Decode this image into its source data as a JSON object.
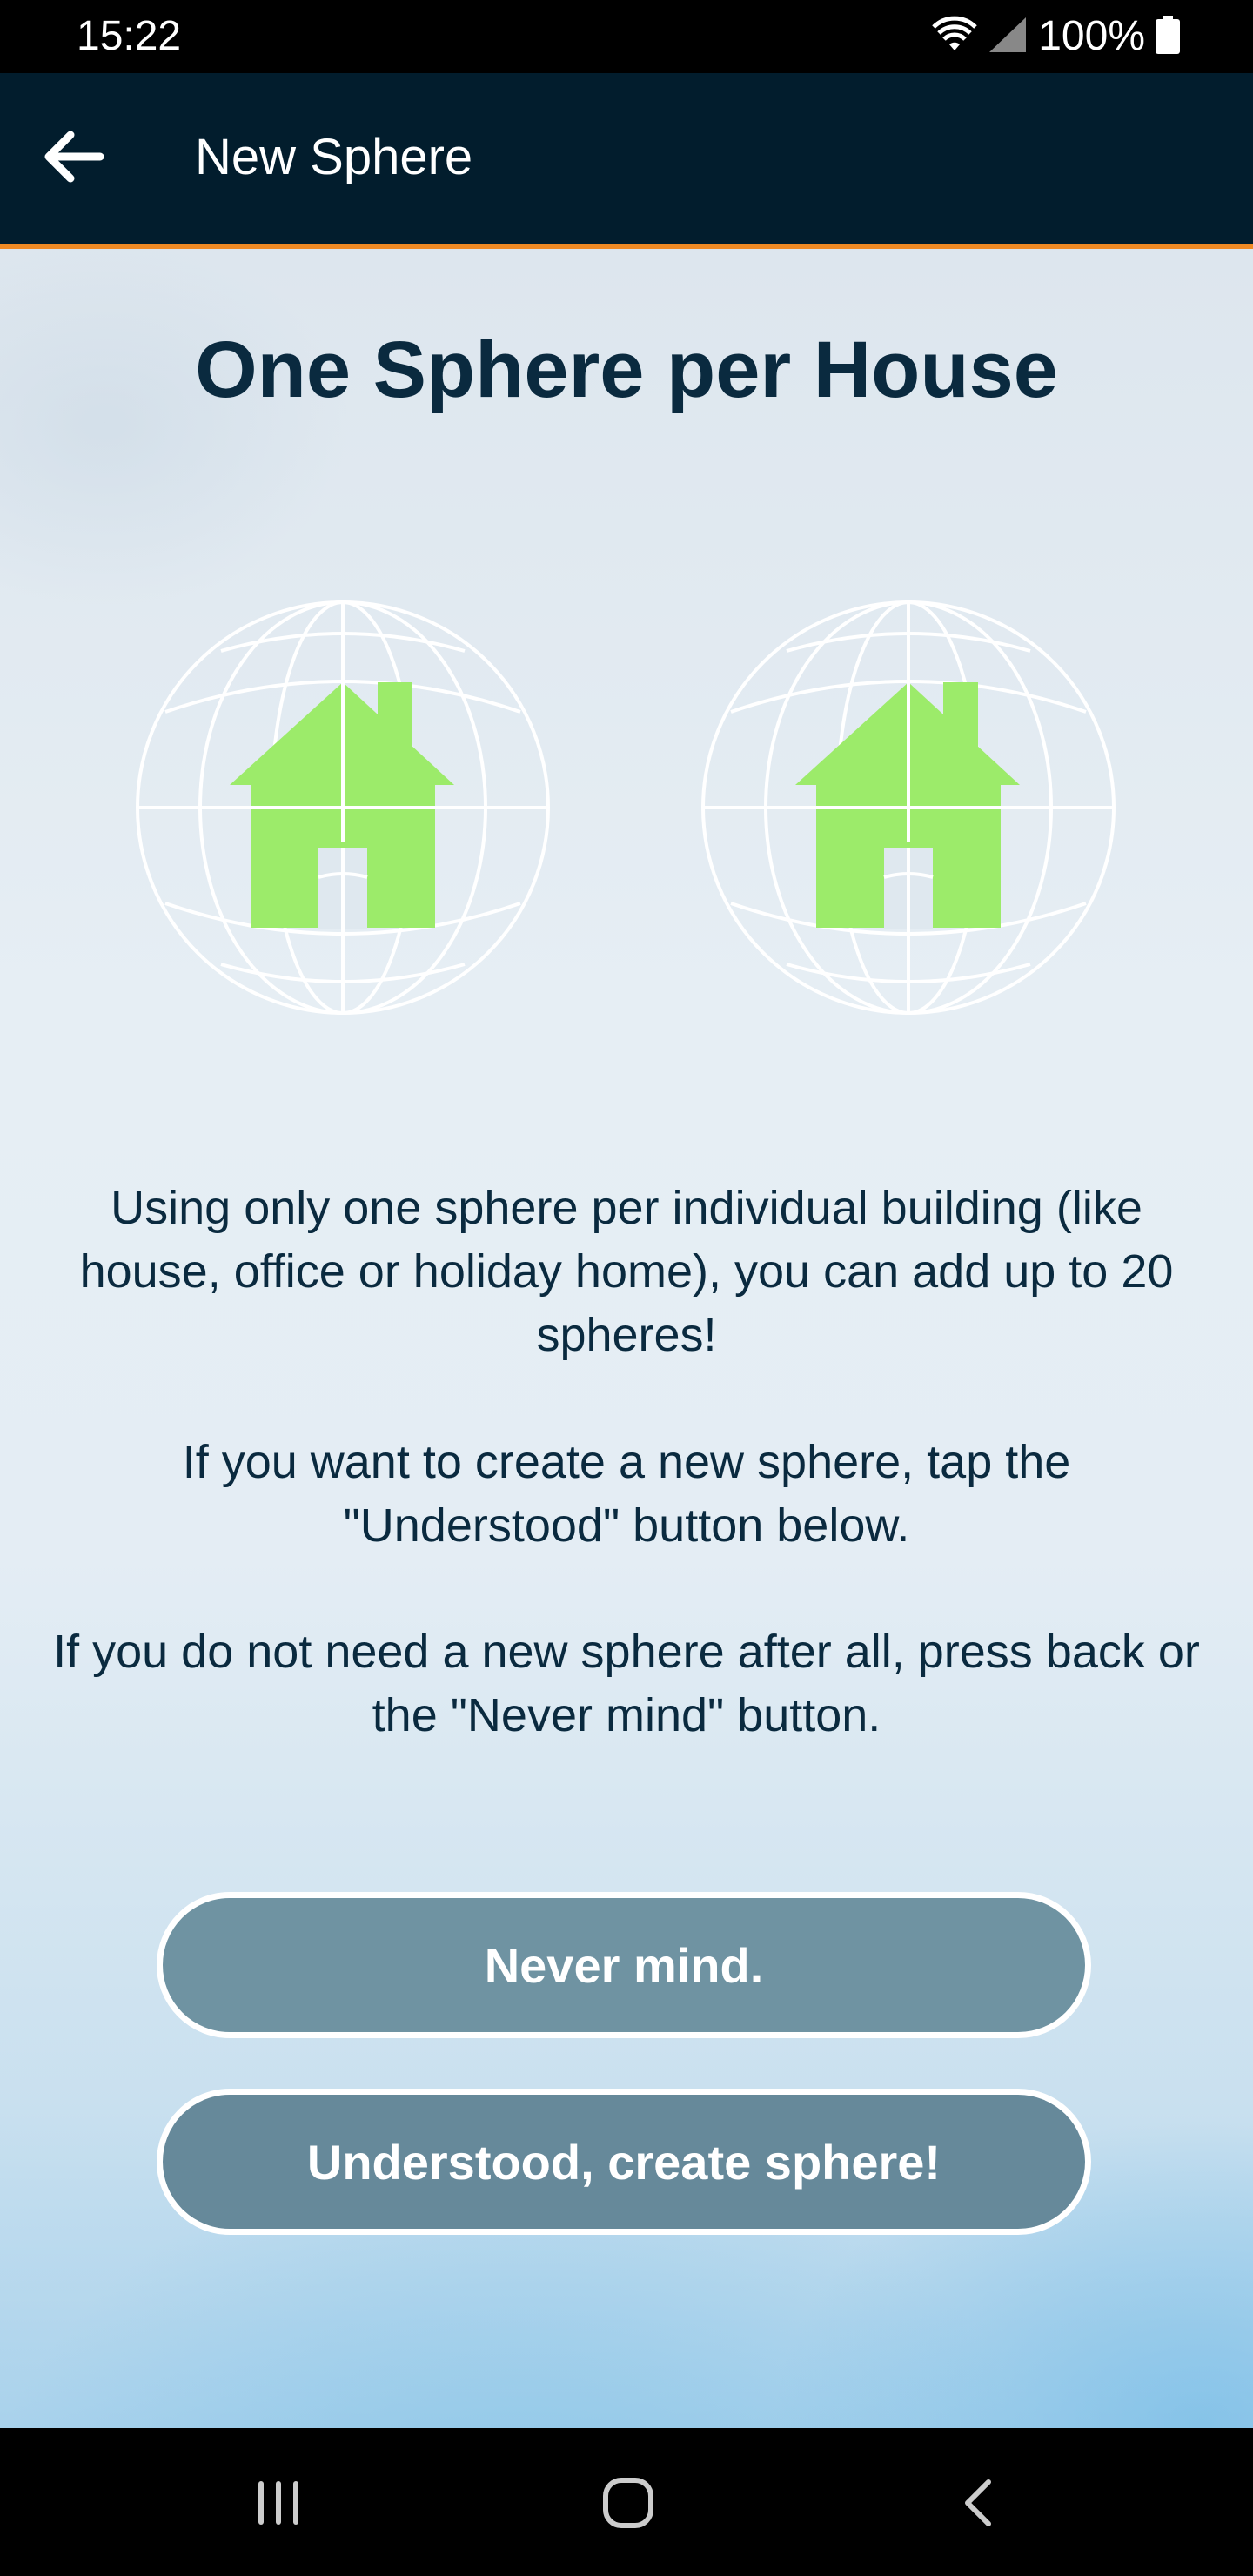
{
  "status_bar": {
    "time": "15:22",
    "battery": "100%",
    "icons": [
      "wifi-icon",
      "signal-icon",
      "battery-icon"
    ]
  },
  "app_bar": {
    "title": "New Sphere",
    "back_icon": "arrow-left-icon",
    "background_color": "#021d2d",
    "accent_color": "#f08a24"
  },
  "main": {
    "headline": "One Sphere per House",
    "illustrations": [
      "sphere-house-icon",
      "sphere-house-icon"
    ],
    "house_color": "#9ceb6a",
    "paragraphs": [
      "Using only one sphere per individual building (like house, office or holiday home), you can add up to 20 spheres!",
      "If you want to create a new sphere, tap the \"Understood\" button below.",
      "If you do not need a new sphere after all, press back or the \"Never mind\" button."
    ],
    "buttons": {
      "never_mind": "Never mind.",
      "understood": "Understood, create sphere!"
    },
    "text_color": "#0a2a3f",
    "button_color": "#6f93a2"
  },
  "nav_bar": {
    "icons": [
      "recents-icon",
      "home-icon",
      "back-icon"
    ]
  }
}
